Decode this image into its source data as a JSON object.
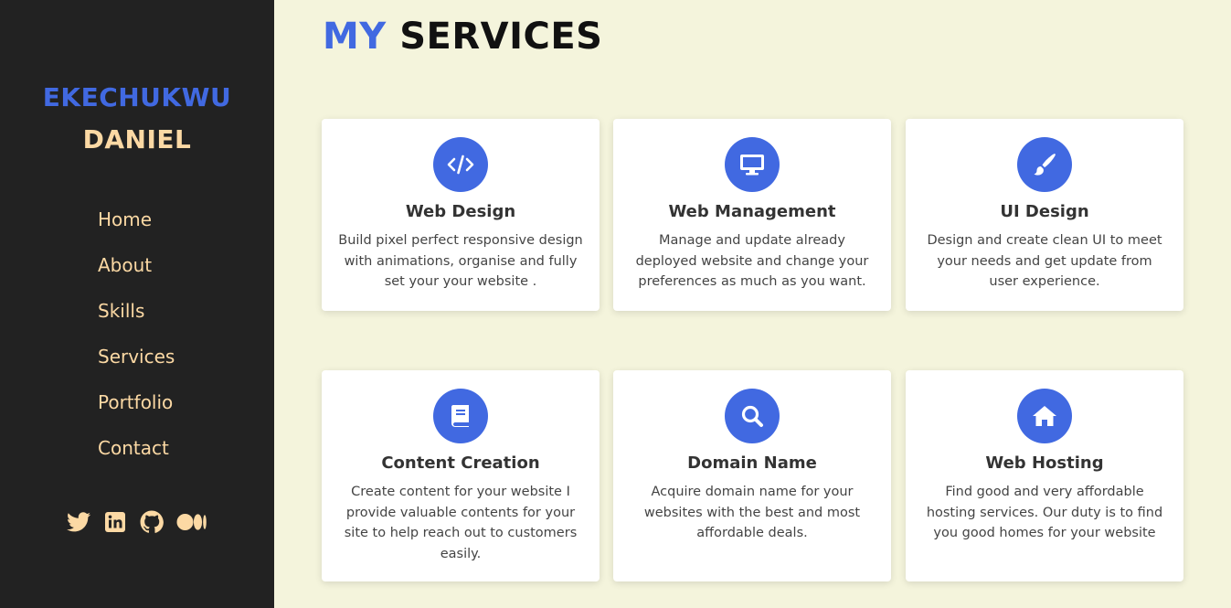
{
  "brand": {
    "first_name": "EKECHUKWU",
    "last_name": "DANIEL"
  },
  "nav": {
    "items": [
      {
        "label": "Home"
      },
      {
        "label": "About"
      },
      {
        "label": "Skills"
      },
      {
        "label": "Services"
      },
      {
        "label": "Portfolio"
      },
      {
        "label": "Contact"
      }
    ]
  },
  "social": {
    "icons": [
      "twitter-icon",
      "linkedin-icon",
      "github-icon",
      "medium-icon"
    ]
  },
  "heading": {
    "accent": "MY",
    "main": "SERVICES"
  },
  "colors": {
    "accent": "#4169e1",
    "sidebar_bg": "#222222",
    "sidebar_text": "#fcd9a4",
    "page_bg": "#f4f4dc"
  },
  "services": [
    {
      "title": "Web Design",
      "description": "Build pixel perfect responsive design with animations, organise and fully set your your website .",
      "icon": "code-icon"
    },
    {
      "title": "Web Management",
      "description": "Manage and update already deployed website and change your preferences as much as you want.",
      "icon": "desktop-icon"
    },
    {
      "title": "UI Design",
      "description": "Design and create clean UI to meet your needs and get update from user experience.",
      "icon": "paintbrush-icon"
    },
    {
      "title": "Content Creation",
      "description": "Create content for your website I provide valuable contents for your site to help reach out to customers easily.",
      "icon": "book-icon"
    },
    {
      "title": "Domain Name",
      "description": "Acquire domain name for your websites with the best and most affordable deals.",
      "icon": "search-icon"
    },
    {
      "title": "Web Hosting",
      "description": "Find good and very affordable hosting services. Our duty is to find you good homes for your website",
      "icon": "home-icon"
    }
  ]
}
